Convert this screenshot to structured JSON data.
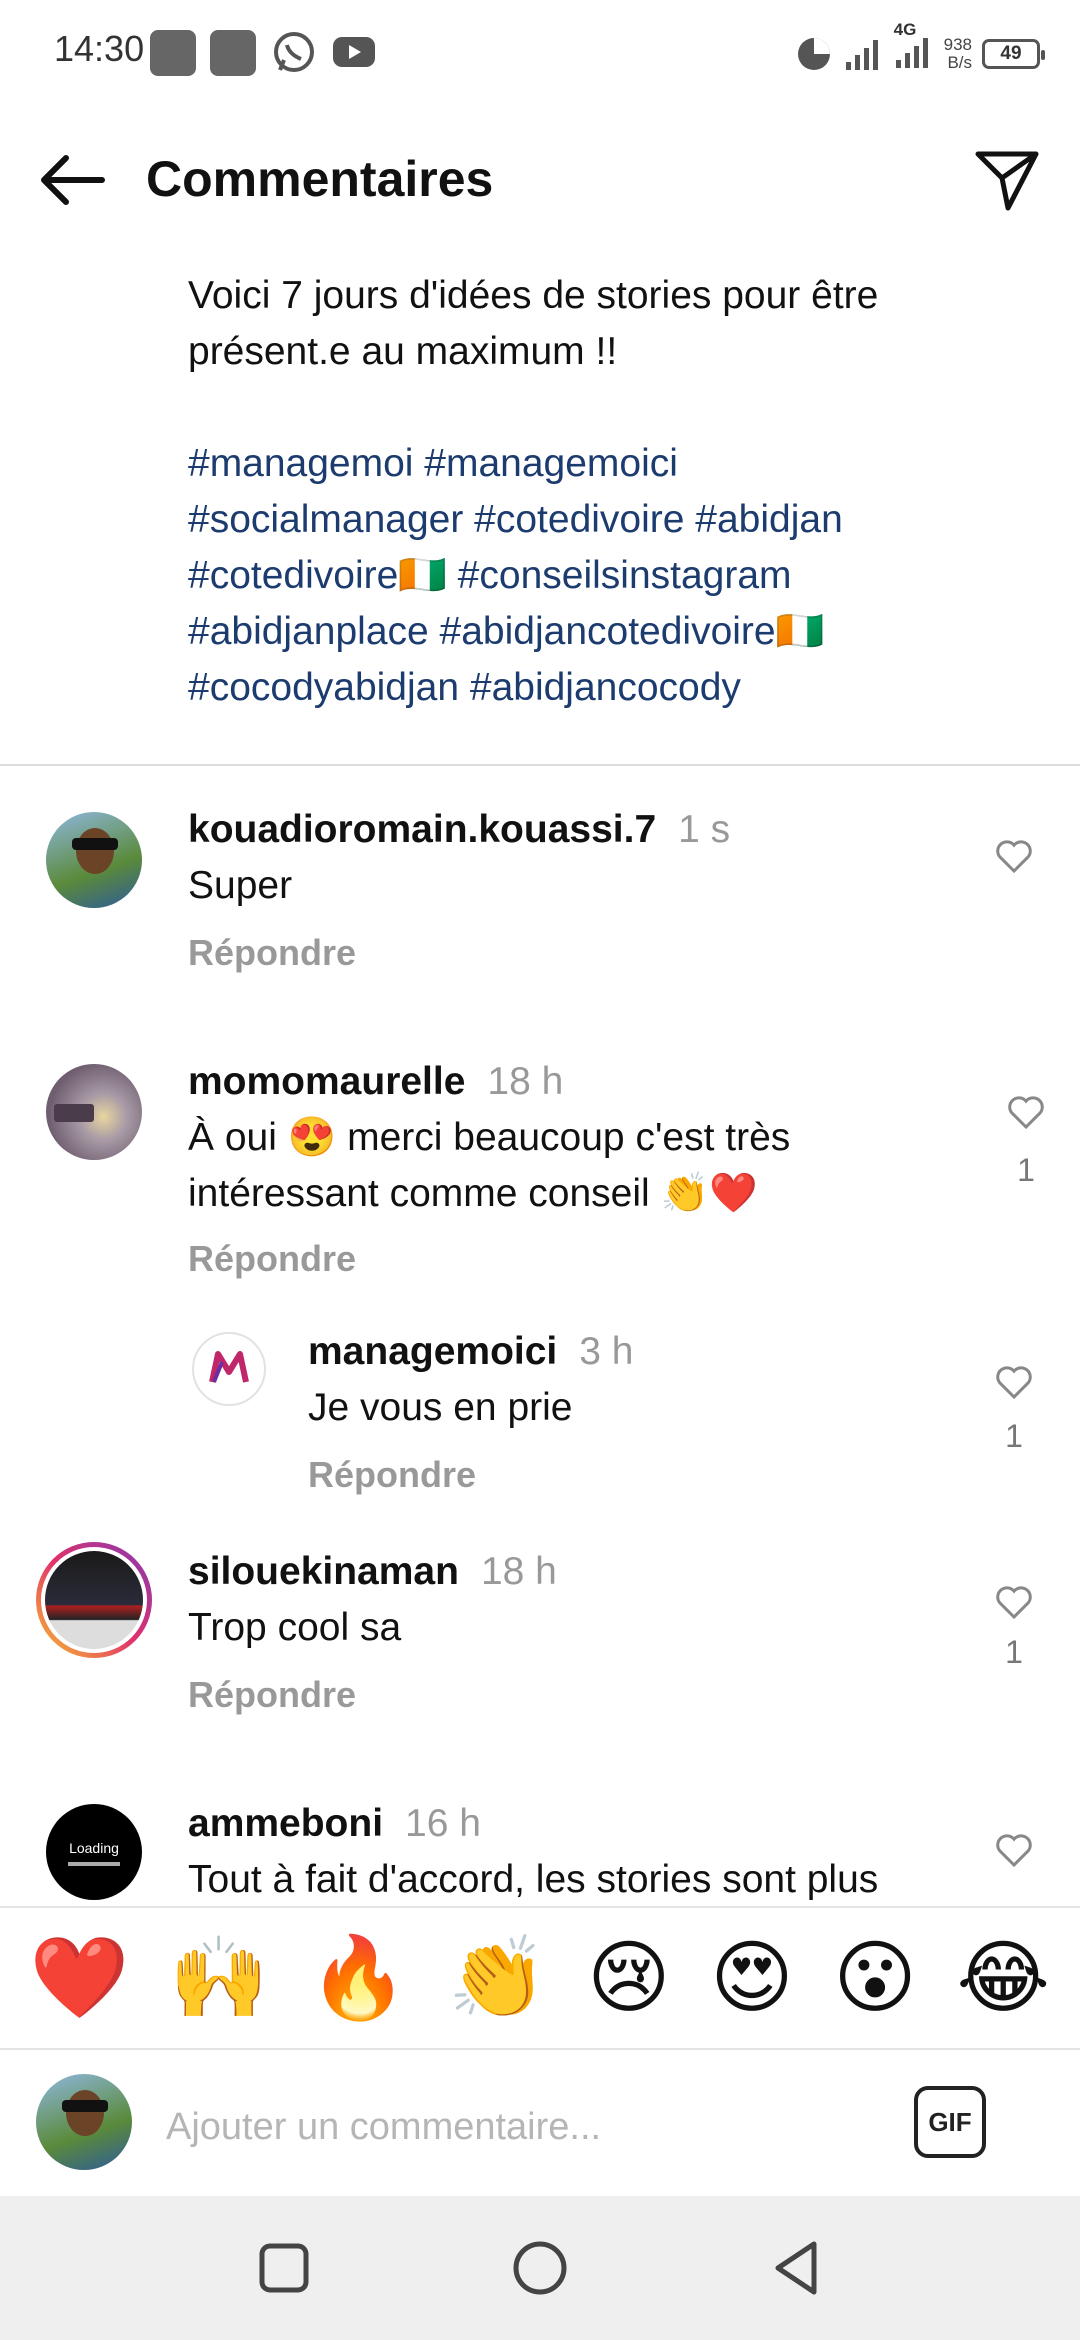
{
  "status_bar": {
    "time": "14:30",
    "network_speed_value": "938",
    "network_speed_unit": "B/s",
    "network_type": "4G",
    "battery": "49"
  },
  "header": {
    "title": "Commentaires"
  },
  "caption": {
    "text": "Voici 7 jours d'idées de stories pour être présent.e au maximum !!",
    "hashtags": [
      "#managemoi #managemoici",
      "#socialmanager #cotedivoire #abidjan",
      "#cotedivoire🇨🇮 #conseilsinstagram",
      "#abidjanplace #abidjancotedivoire🇨🇮",
      "#cocodyabidjan #abidjancocody"
    ]
  },
  "comments": [
    {
      "username": "kouadioromain.kouassi.7",
      "time": "1 s",
      "text": "Super",
      "reply_label": "Répondre",
      "likes": ""
    },
    {
      "username": "momomaurelle",
      "time": "18 h",
      "text": "À oui 😍 merci beaucoup c'est très intéressant comme conseil 👏❤️",
      "reply_label": "Répondre",
      "likes": "1"
    },
    {
      "username": "managemoici",
      "time": "3 h",
      "text": "Je vous en prie",
      "reply_label": "Répondre",
      "likes": "1"
    },
    {
      "username": "silouekinaman",
      "time": "18 h",
      "text": "Trop cool sa",
      "reply_label": "Répondre",
      "likes": "1"
    },
    {
      "username": "ammeboni",
      "time": "16 h",
      "text": "Tout à fait d'accord, les stories sont plus",
      "reply_label": "",
      "likes": ""
    }
  ],
  "avatar_text": {
    "ammeboni": "Loading"
  },
  "emoji_bar": [
    "❤️",
    "🙌",
    "🔥",
    "👏",
    "😢",
    "😍",
    "😮",
    "😂"
  ],
  "input_bar": {
    "placeholder": "Ajouter un commentaire...",
    "gif_label": "GIF"
  },
  "colors": {
    "hashtag": "#1c3b6e",
    "secondary_text": "#999999",
    "story_ring": "#e1306c"
  }
}
